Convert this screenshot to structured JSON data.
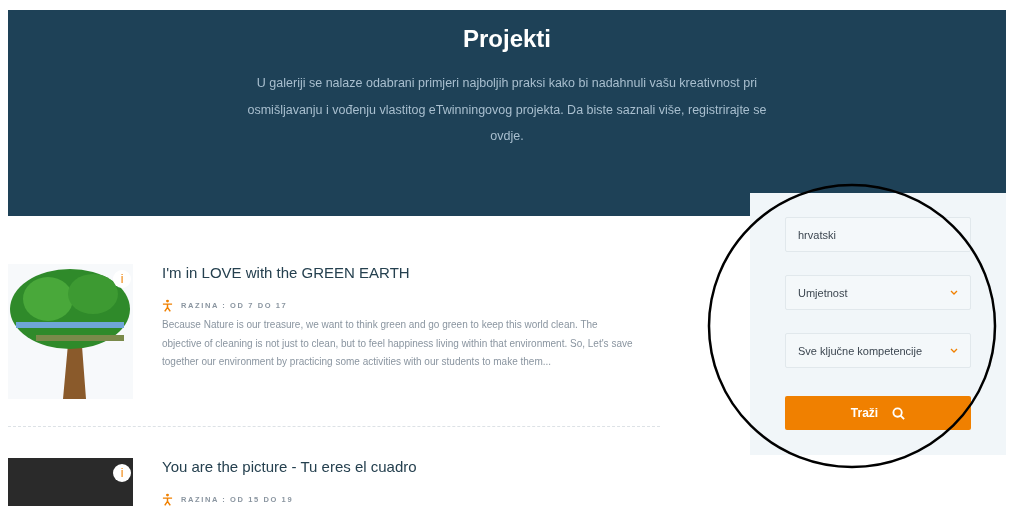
{
  "header": {
    "title": "Projekti",
    "intro": "U galeriji se nalaze odabrani primjeri najboljih praksi kako bi nadahnuli vašu kreativnost pri osmišljavanju i vođenju vlastitog eTwinningovog projekta. Da biste saznali više, registrirajte se ovdje."
  },
  "projects": [
    {
      "kind": "tree",
      "info_badge": "i",
      "title": "I'm in LOVE with the GREEN EARTH",
      "level": "RAZINA : OD 7 DO 17",
      "description": "Because Nature is our treasure, we want to think green and go green to keep this world clean. The objective of cleaning is not just to clean, but to feel happiness living within that environment. So, Let's save together our environment by practicing some activities with our students to make them..."
    },
    {
      "kind": "photo",
      "info_badge": "i",
      "title": "You are the picture - Tu eres el cuadro",
      "level": "RAZINA : OD 15 DO 19"
    }
  ],
  "filters": {
    "fields": [
      {
        "kind": "text",
        "value": "hrvatski"
      },
      {
        "kind": "select",
        "value": "Umjetnost"
      },
      {
        "kind": "select",
        "value": "Sve ključne kompetencije"
      }
    ],
    "button": "Traži"
  }
}
